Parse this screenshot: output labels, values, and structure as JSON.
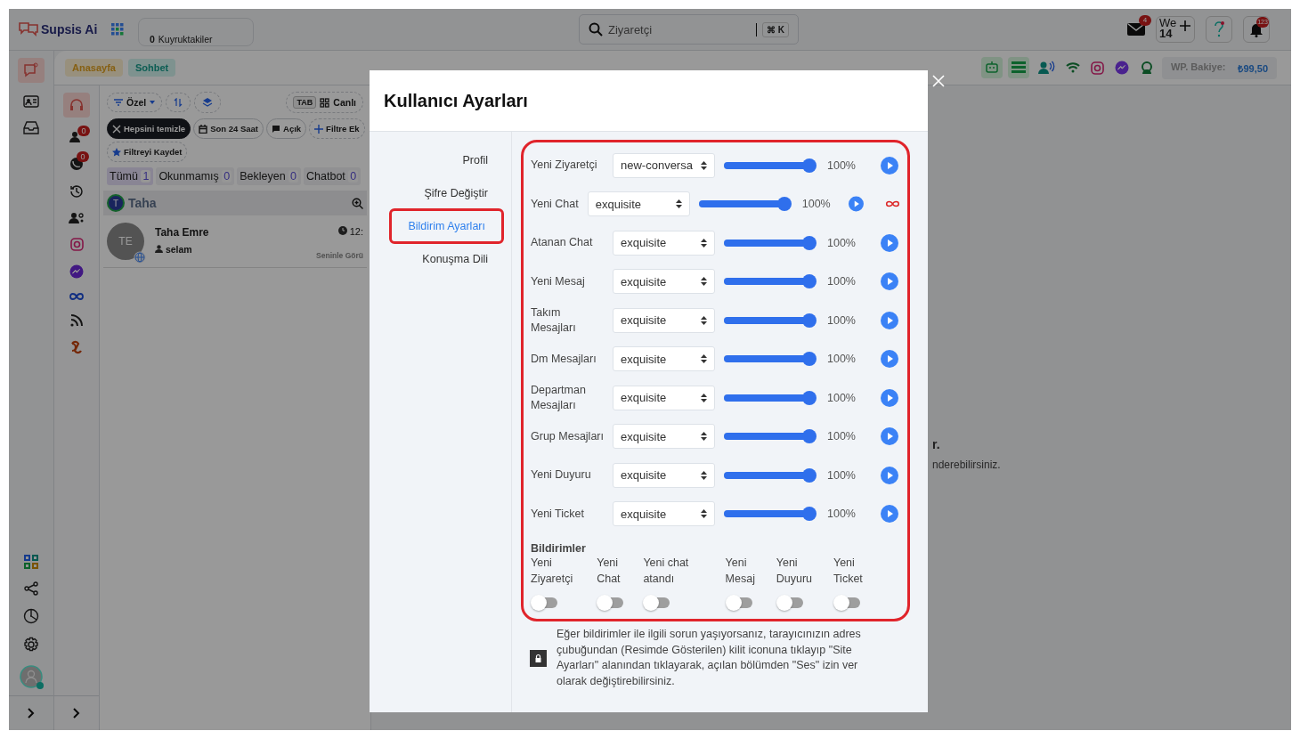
{
  "topbar": {
    "brand": "Supsis Ai",
    "queue": {
      "count": "0",
      "label": "Kuyruktakiler"
    },
    "search": {
      "value": "Ziyaretçi",
      "shortcut": "⌘ K"
    },
    "mail_badge": "4",
    "team": {
      "label": "We",
      "count": "14"
    },
    "bell_badge": "123"
  },
  "side_badges": [
    "0",
    "0"
  ],
  "breadcrumbs": [
    {
      "label": "Anasayfa",
      "kind": "home"
    },
    {
      "label": "Sohbet",
      "kind": "chat"
    }
  ],
  "wallet": {
    "label": "WP. Bakiye:",
    "amount": "₺99,50"
  },
  "chat_list": {
    "filter": "Özel",
    "tab_key": "TAB",
    "live": "Canlı",
    "chips": [
      {
        "kind": "clear",
        "label": "Hepsini temizle"
      },
      {
        "kind": "date",
        "label": "Son 24 Saat"
      },
      {
        "kind": "status",
        "label": "Açık"
      },
      {
        "kind": "add",
        "label": "Filtre Ek"
      },
      {
        "kind": "save",
        "label": "Filtreyi Kaydet"
      }
    ],
    "tabs": [
      {
        "label": "Tümü",
        "count": "1",
        "selected": true
      },
      {
        "label": "Okunmamış",
        "count": "0",
        "selected": false
      },
      {
        "label": "Bekleyen",
        "count": "0",
        "selected": false
      },
      {
        "label": "Chatbot",
        "count": "0",
        "selected": false
      }
    ],
    "group": {
      "initial": "T",
      "name": "Taha"
    },
    "conversation": {
      "initials": "TE",
      "name": "Taha Emre",
      "message": "selam",
      "time": "12:",
      "note": "Seninle Görü"
    }
  },
  "backdrop_texts": [
    "r.",
    "nderebilirsiniz."
  ],
  "modal": {
    "title": "Kullanıcı Ayarları",
    "menu": [
      {
        "label": "Profil",
        "selected": false
      },
      {
        "label": "Şifre Değiştir",
        "selected": false
      },
      {
        "label": "Bildirim Ayarları",
        "selected": true
      },
      {
        "label": "Konuşma Dili",
        "selected": false
      }
    ],
    "sounds": [
      {
        "label": "Yeni Ziyaretçi",
        "sound": "new-conversa",
        "level": 1,
        "reading": "100%",
        "kind": "plain"
      },
      {
        "label": "Yeni Chat",
        "sound": "exquisite",
        "level": 1,
        "reading": "100%",
        "kind": "loop"
      },
      {
        "label": "Atanan Chat",
        "sound": "exquisite",
        "level": 1,
        "reading": "100%",
        "kind": "plain"
      },
      {
        "label": "Yeni Mesaj",
        "sound": "exquisite",
        "level": 1,
        "reading": "100%",
        "kind": "plain"
      },
      {
        "label": "Takım Mesajları",
        "sound": "exquisite",
        "level": 1,
        "reading": "100%",
        "kind": "plain"
      },
      {
        "label": "Dm Mesajları",
        "sound": "exquisite",
        "level": 1,
        "reading": "100%",
        "kind": "plain"
      },
      {
        "label": "Departman Mesajları",
        "sound": "exquisite",
        "level": 1,
        "reading": "100%",
        "kind": "plain"
      },
      {
        "label": "Grup Mesajları",
        "sound": "exquisite",
        "level": 1,
        "reading": "100%",
        "kind": "plain"
      },
      {
        "label": "Yeni Duyuru",
        "sound": "exquisite",
        "level": 1,
        "reading": "100%",
        "kind": "plain"
      },
      {
        "label": "Yeni Ticket",
        "sound": "exquisite",
        "level": 1,
        "reading": "100%",
        "kind": "plain"
      }
    ],
    "notifications": {
      "title": "Bildirimler",
      "toggles": [
        {
          "label": "Yeni Ziyaretçi",
          "on": false
        },
        {
          "label": "Yeni Chat",
          "on": false
        },
        {
          "label": "Yeni chat atandı",
          "on": false
        },
        {
          "label": "Yeni Mesaj",
          "on": false
        },
        {
          "label": "Yeni Duyuru",
          "on": false
        },
        {
          "label": "Yeni Ticket",
          "on": false
        }
      ]
    },
    "info": "Eğer bildirimler ile ilgili sorun yaşıyorsanız, tarayıcınızın adres çubuğundan (Resimde Gösterilen) kilit iconuna tıklayıp \"Site Ayarları\" alanından tıklayarak, açılan bölümden \"Ses\" izin ver olarak değiştirebilirsiniz."
  }
}
